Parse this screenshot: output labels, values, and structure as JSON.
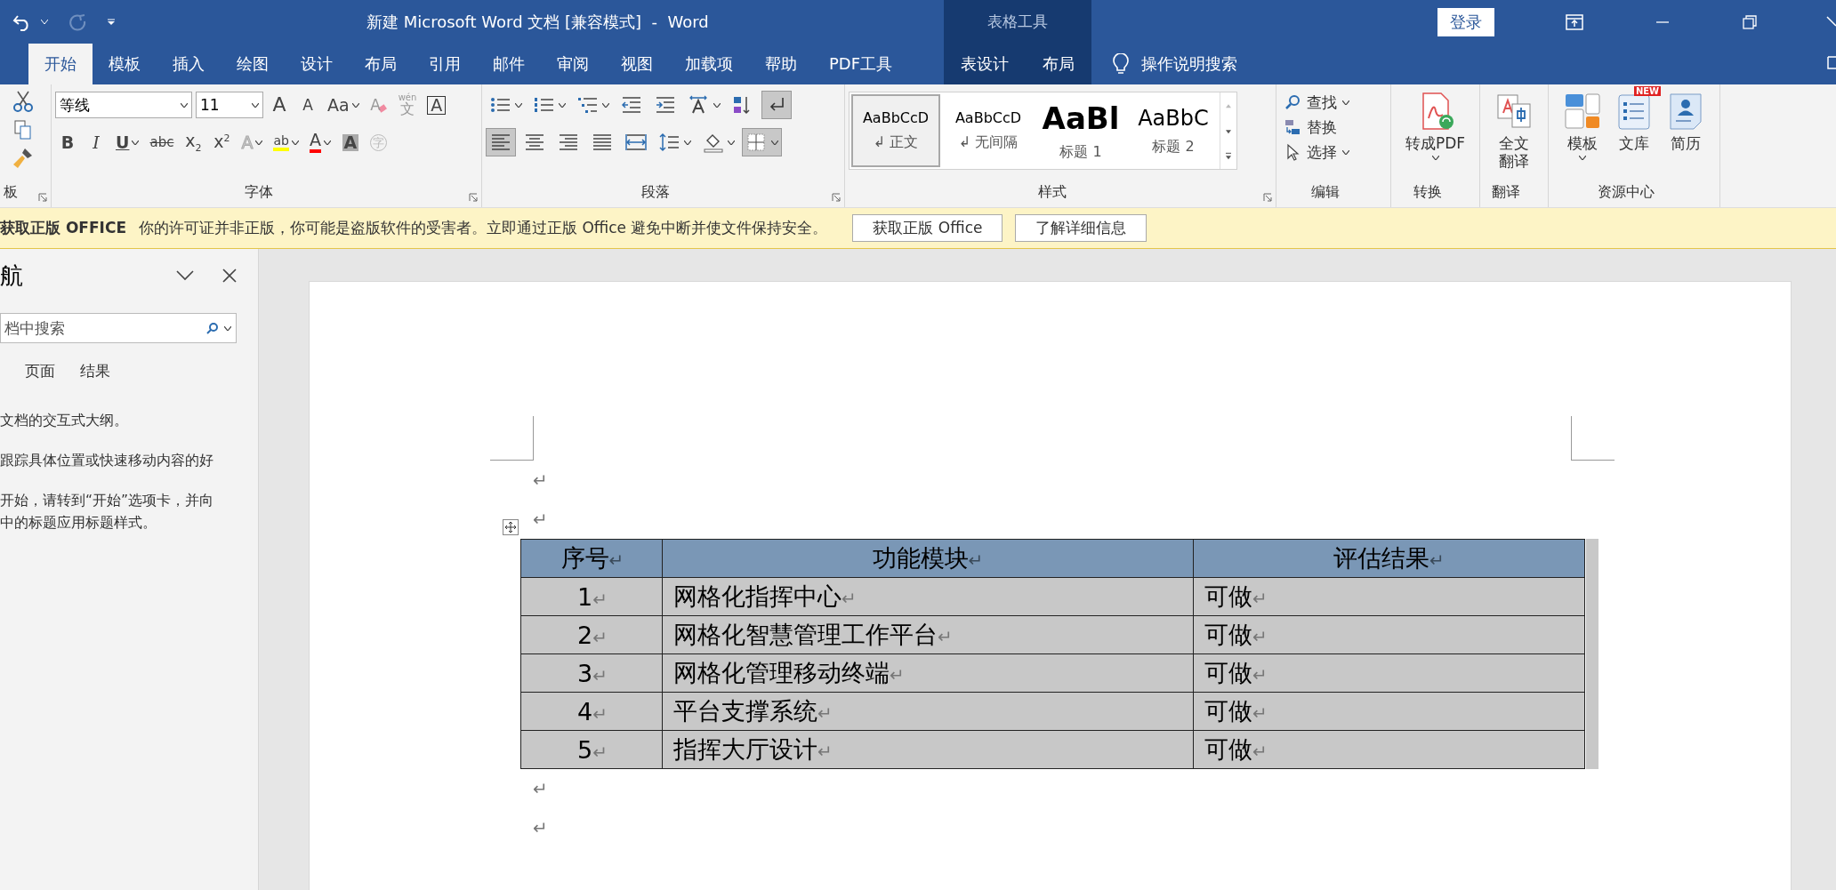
{
  "title_bar": {
    "title": "新建 Microsoft Word 文档 [兼容模式]  -  Word",
    "context_label": "表格工具",
    "login": "登录"
  },
  "tabs": [
    {
      "label": "开始",
      "selected": true,
      "contextual": false
    },
    {
      "label": "模板",
      "selected": false,
      "contextual": false
    },
    {
      "label": "插入",
      "selected": false,
      "contextual": false
    },
    {
      "label": "绘图",
      "selected": false,
      "contextual": false
    },
    {
      "label": "设计",
      "selected": false,
      "contextual": false
    },
    {
      "label": "布局",
      "selected": false,
      "contextual": false
    },
    {
      "label": "引用",
      "selected": false,
      "contextual": false
    },
    {
      "label": "邮件",
      "selected": false,
      "contextual": false
    },
    {
      "label": "审阅",
      "selected": false,
      "contextual": false
    },
    {
      "label": "视图",
      "selected": false,
      "contextual": false
    },
    {
      "label": "加载项",
      "selected": false,
      "contextual": false
    },
    {
      "label": "帮助",
      "selected": false,
      "contextual": false
    },
    {
      "label": "PDF工具",
      "selected": false,
      "contextual": false
    },
    {
      "label": "表设计",
      "selected": false,
      "contextual": true
    },
    {
      "label": "布局",
      "selected": false,
      "contextual": true
    }
  ],
  "tell_me": "操作说明搜索",
  "ribbon": {
    "clipboard": {
      "label": "板"
    },
    "font": {
      "label": "字体",
      "font_name": "等线",
      "font_size": "11",
      "row1": [
        {
          "kind": "grow",
          "label": "A"
        },
        {
          "kind": "shrink",
          "label": "A"
        },
        {
          "kind": "case",
          "label": "Aa"
        },
        {
          "kind": "clear",
          "label": "A"
        },
        {
          "kind": "phonetic",
          "label": "文",
          "ruby": "wén"
        },
        {
          "kind": "border",
          "label": "A"
        }
      ],
      "row2": [
        {
          "kind": "bold",
          "label": "B"
        },
        {
          "kind": "italic",
          "label": "I"
        },
        {
          "kind": "underline",
          "label": "U"
        },
        {
          "kind": "strike",
          "label": "abc"
        },
        {
          "kind": "sub",
          "label": "x$_{2}$"
        },
        {
          "kind": "sup",
          "label": "x$^{2}$"
        },
        {
          "kind": "effects",
          "label": "A"
        },
        {
          "kind": "highlight",
          "label": "ab",
          "color": "#ffff00"
        },
        {
          "kind": "fontcolor",
          "label": "A",
          "color": "#ff0000"
        },
        {
          "kind": "shade",
          "label": "A"
        },
        {
          "kind": "enclose",
          "label": "字"
        }
      ]
    },
    "paragraph": {
      "label": "段落",
      "row1": [
        {
          "kind": "bullets",
          "on": false
        },
        {
          "kind": "numbering",
          "on": false
        },
        {
          "kind": "multilevel",
          "on": false
        },
        {
          "kind": "outdent",
          "on": false
        },
        {
          "kind": "indent",
          "on": false
        },
        {
          "kind": "direction",
          "on": false
        },
        {
          "kind": "sort",
          "on": false
        },
        {
          "kind": "marks",
          "on": true
        }
      ],
      "row2": [
        {
          "kind": "left",
          "on": true
        },
        {
          "kind": "center",
          "on": false
        },
        {
          "kind": "right",
          "on": false
        },
        {
          "kind": "justify",
          "on": false
        },
        {
          "kind": "distributed",
          "on": false
        },
        {
          "kind": "spacing",
          "on": false
        },
        {
          "kind": "shading",
          "on": false
        },
        {
          "kind": "borders",
          "on": true
        }
      ]
    },
    "styles": {
      "label": "样式",
      "items": [
        {
          "preview": "AaBbCcD",
          "name": "↲ 正文",
          "selected": true,
          "kind": "normal"
        },
        {
          "preview": "AaBbCcD",
          "name": "↲ 无间隔",
          "selected": false,
          "kind": "normal"
        },
        {
          "preview": "AaBl",
          "name": "标题 1",
          "selected": false,
          "kind": "heading1"
        },
        {
          "preview": "AaBbC",
          "name": "标题 2",
          "selected": false,
          "kind": "heading2"
        }
      ]
    },
    "editing": {
      "label": "编辑",
      "items": [
        {
          "kind": "find",
          "label": "查找"
        },
        {
          "kind": "replace",
          "label": "替换"
        },
        {
          "kind": "select",
          "label": "选择"
        }
      ]
    },
    "big_groups": [
      {
        "label": "转换",
        "buttons": [
          {
            "kind": "pdf",
            "label": "转成PDF"
          }
        ]
      },
      {
        "label": "翻译",
        "buttons": [
          {
            "kind": "translate",
            "label": "全文翻译"
          }
        ]
      },
      {
        "label": "资源中心",
        "buttons": [
          {
            "kind": "template",
            "label": "模板"
          },
          {
            "kind": "library",
            "label": "文库",
            "badge": "NEW"
          },
          {
            "kind": "resume",
            "label": "简历"
          }
        ]
      }
    ]
  },
  "info_bar": {
    "title": "获取正版 OFFICE",
    "message": "你的许可证并非正版，你可能是盗版软件的受害者。立即通过正版 Office 避免中断并使文件保持安全。",
    "buttons": [
      "获取正版 Office",
      "了解详细信息"
    ]
  },
  "nav_pane": {
    "title": "航",
    "search_placeholder": "档中搜索",
    "tabs": [
      {
        "label": "页面",
        "selected": false
      },
      {
        "label": "结果",
        "selected": false
      }
    ],
    "paragraphs": [
      [
        "文档的交互式大纲。"
      ],
      [
        "跟踪具体位置或快速移动内容的好"
      ],
      [
        "开始，请转到“开始”选项卡，并向",
        "中的标题应用标题样式。"
      ]
    ]
  },
  "document": {
    "before_table": [
      "↵",
      "↵"
    ],
    "table": {
      "selected": true,
      "header": [
        {
          "text": "序号",
          "mark": "↵"
        },
        {
          "text": "功能模块",
          "mark": "↵"
        },
        {
          "text": "评估结果",
          "mark": "↵"
        }
      ],
      "rows": [
        {
          "cells": [
            {
              "text": "1",
              "mark": "↵"
            },
            {
              "text": "网格化指挥中心",
              "mark": "↵"
            },
            {
              "text": "可做",
              "mark": "↵"
            }
          ]
        },
        {
          "cells": [
            {
              "text": "2",
              "mark": "↵"
            },
            {
              "text": "网格化智慧管理工作平台",
              "mark": "↵"
            },
            {
              "text": "可做",
              "mark": "↵"
            }
          ]
        },
        {
          "cells": [
            {
              "text": "3",
              "mark": "↵"
            },
            {
              "text": "网格化管理移动终端",
              "mark": "↵"
            },
            {
              "text": "可做",
              "mark": "↵"
            }
          ]
        },
        {
          "cells": [
            {
              "text": "4",
              "mark": "↵"
            },
            {
              "text": "平台支撑系统",
              "mark": "↵"
            },
            {
              "text": "可做",
              "mark": "↵"
            }
          ]
        },
        {
          "cells": [
            {
              "text": "5",
              "mark": "↵"
            },
            {
              "text": "指挥大厅设计",
              "mark": "↵"
            },
            {
              "text": "可做",
              "mark": "↵"
            }
          ]
        }
      ]
    },
    "after_table": [
      "↵",
      "↵"
    ]
  }
}
